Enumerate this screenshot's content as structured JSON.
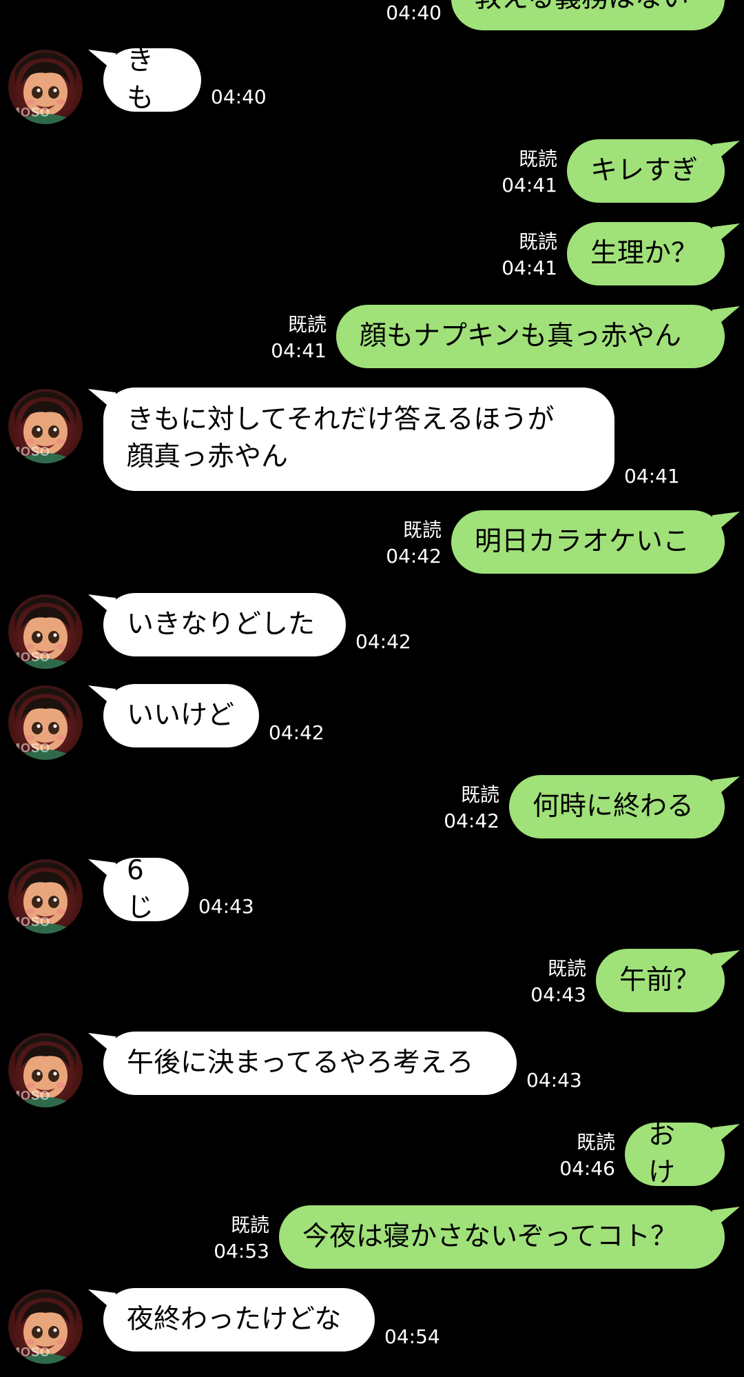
{
  "read_label": "既読",
  "avatar_watermark": "MOSO",
  "messages": [
    {
      "side": "out",
      "text": "教える義務はない",
      "time": "04:40"
    },
    {
      "side": "in",
      "text": "きも",
      "time": "04:40"
    },
    {
      "side": "out",
      "text": "キレすぎ",
      "time": "04:41",
      "read": true
    },
    {
      "side": "out",
      "text": "生理か？",
      "time": "04:41",
      "read": true
    },
    {
      "side": "out",
      "text": "顔もナプキンも真っ赤やん",
      "time": "04:41",
      "read": true
    },
    {
      "side": "in",
      "text": "きもに対してそれだけ答えるほうが\n顔真っ赤やん",
      "time": "04:41"
    },
    {
      "side": "out",
      "text": "明日カラオケいこ",
      "time": "04:42",
      "read": true
    },
    {
      "side": "in",
      "text": "いきなりどした",
      "time": "04:42"
    },
    {
      "side": "in",
      "text": "いいけど",
      "time": "04:42"
    },
    {
      "side": "out",
      "text": "何時に終わる",
      "time": "04:42",
      "read": true
    },
    {
      "side": "in",
      "text": "6じ",
      "time": "04:43"
    },
    {
      "side": "out",
      "text": "午前？",
      "time": "04:43",
      "read": true
    },
    {
      "side": "in",
      "text": "午後に決まってるやろ考えろ",
      "time": "04:43"
    },
    {
      "side": "out",
      "text": "おけ",
      "time": "04:46",
      "read": true
    },
    {
      "side": "out",
      "text": "今夜は寝かさないぞってコト？",
      "time": "04:53",
      "read": true
    },
    {
      "side": "in",
      "text": "夜終わったけどな",
      "time": "04:54"
    }
  ]
}
